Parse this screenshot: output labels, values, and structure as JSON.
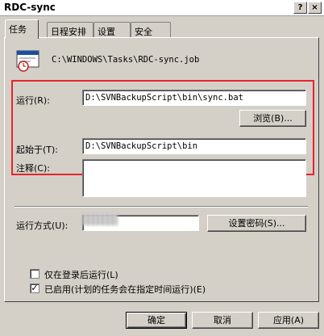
{
  "window": {
    "title": "RDC-sync",
    "help_btn": "?",
    "close_btn": "×"
  },
  "tabs": [
    "任务",
    "日程安排",
    "设置",
    "安全"
  ],
  "task": {
    "path": "C:\\WINDOWS\\Tasks\\RDC-sync.job",
    "run_label": "运行(R):",
    "run_value": "D:\\SVNBackupScript\\bin\\sync.bat",
    "browse_label": "浏览(B)...",
    "start_in_label": "起始于(T):",
    "start_in_value": "D:\\SVNBackupScript\\bin",
    "comment_label": "注释(C):",
    "comment_value": "",
    "run_as_label": "运行方式(U):",
    "set_password_label": "设置密码(S)...",
    "only_logged_on_label": "仅在登录后运行(L)",
    "only_logged_on_checked": false,
    "enabled_label": "已启用(计划的任务会在指定时间运行)(E)",
    "enabled_checked": true
  },
  "buttons": {
    "ok": "确定",
    "cancel": "取消",
    "apply": "应用(A)"
  }
}
